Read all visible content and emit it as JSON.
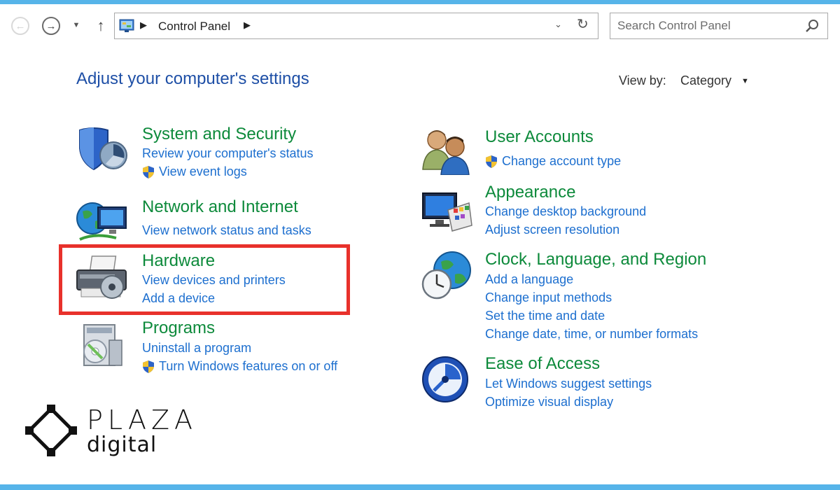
{
  "window": {
    "accent_color": "#56b4e9"
  },
  "navigation": {
    "back_icon": "back-arrow-icon",
    "forward_icon": "forward-arrow-icon",
    "recent_icon": "chevron-down-icon",
    "up_icon": "up-arrow-icon"
  },
  "address_bar": {
    "location_icon": "control-panel-icon",
    "breadcrumb": "Control Panel",
    "dropdown_icon": "chevron-down-icon",
    "refresh_icon": "refresh-icon"
  },
  "search": {
    "placeholder": "Search Control Panel",
    "value": "",
    "icon": "search-icon"
  },
  "header": {
    "title": "Adjust your computer's settings",
    "view_by_label": "View by:",
    "view_by_value": "Category"
  },
  "categories_left": [
    {
      "title": "System and Security",
      "icon": "shield-icon",
      "links": [
        {
          "label": "Review your computer's status",
          "shield": false
        },
        {
          "label": "View event logs",
          "shield": true
        }
      ]
    },
    {
      "title": "Network and Internet",
      "icon": "globe-network-icon",
      "links": [
        {
          "label": "View network status and tasks",
          "shield": false
        }
      ]
    },
    {
      "title": "Hardware",
      "icon": "printer-icon",
      "highlighted": true,
      "links": [
        {
          "label": "View devices and printers",
          "shield": false
        },
        {
          "label": "Add a device",
          "shield": false
        }
      ]
    },
    {
      "title": "Programs",
      "icon": "programs-icon",
      "links": [
        {
          "label": "Uninstall a program",
          "shield": false
        },
        {
          "label": "Turn Windows features on or off",
          "shield": true
        }
      ]
    }
  ],
  "categories_right": [
    {
      "title": "User Accounts",
      "icon": "users-icon",
      "links": [
        {
          "label": "Change account type",
          "shield": true
        }
      ]
    },
    {
      "title": "Appearance",
      "icon": "appearance-icon",
      "links": [
        {
          "label": "Change desktop background",
          "shield": false
        },
        {
          "label": "Adjust screen resolution",
          "shield": false
        }
      ]
    },
    {
      "title": "Clock, Language, and Region",
      "icon": "clock-globe-icon",
      "links": [
        {
          "label": "Add a language",
          "shield": false
        },
        {
          "label": "Change input methods",
          "shield": false
        },
        {
          "label": "Set the time and date",
          "shield": false
        },
        {
          "label": "Change date, time, or number formats",
          "shield": false
        }
      ]
    },
    {
      "title": "Ease of Access",
      "icon": "ease-of-access-icon",
      "links": [
        {
          "label": "Let Windows suggest settings",
          "shield": false
        },
        {
          "label": "Optimize visual display",
          "shield": false
        }
      ]
    }
  ],
  "colors": {
    "title_green": "#0d8a3b",
    "link_blue": "#1d6fcf",
    "heading_blue": "#1e4fa6",
    "highlight_red": "#e8312b"
  },
  "watermark": {
    "title": "PLAZA",
    "subtitle": "digital"
  }
}
